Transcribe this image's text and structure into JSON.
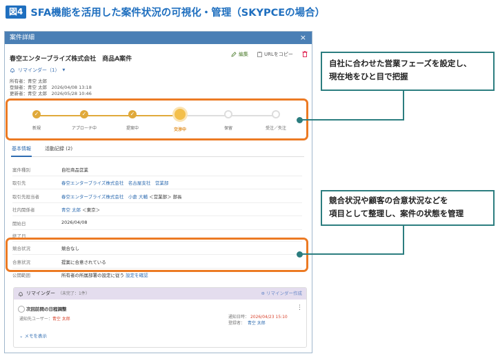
{
  "figure": {
    "badge": "図4",
    "title": "SFA機能を活用した案件状況の可視化・管理（SKYPCEの場合）"
  },
  "panel": {
    "header_title": "案件詳細",
    "close_glyph": "×",
    "deal_title": "春空エンターブライズ株式会社　商品A案件",
    "actions": {
      "edit": "編集",
      "copy_url": "URLをコピー"
    },
    "reminder_label": "リマインダー（1）",
    "meta": [
      {
        "label": "所有者：",
        "value": "青空 太郎"
      },
      {
        "label": "登録者：",
        "value": "青空 太郎　2026/04/08 13:18"
      },
      {
        "label": "更新者：",
        "value": "青空 太郎　2026/05/28 10:46"
      }
    ],
    "stages": [
      {
        "label": "新規",
        "status": "done"
      },
      {
        "label": "アプローチ中",
        "status": "done"
      },
      {
        "label": "提案中",
        "status": "done"
      },
      {
        "label": "交渉中",
        "status": "current"
      },
      {
        "label": "保留",
        "status": "todo"
      },
      {
        "label": "受注／失注",
        "status": "todo"
      }
    ],
    "tabs": [
      {
        "label": "基本情報",
        "active": true
      },
      {
        "label": "活動記録 (2)",
        "active": false
      }
    ],
    "fields": [
      {
        "label": "案件種別",
        "value": "自社商品営業"
      },
      {
        "label": "取引先",
        "value": "春空エンターブライズ株式会社　名古屋支社　営業部"
      },
      {
        "label": "取引先担当者",
        "link": "春空エンターブライズ株式会社　小倉 大輔",
        "suffix": "＜営業部＞ 部長"
      },
      {
        "label": "社内関係者",
        "link": "青空 太郎",
        "suffix": "＜東京＞"
      },
      {
        "label": "開始日",
        "value": "2026/04/08"
      },
      {
        "label": "終了日",
        "value": ""
      },
      {
        "label": "競合状況",
        "value": "競合なし"
      },
      {
        "label": "合意状況",
        "value": "提案に合意されている"
      },
      {
        "label": "公開範囲",
        "value": "所有者の所属部署の設定に従う",
        "link": "設定を確認"
      }
    ],
    "reminder_box": {
      "title": "リマインダー",
      "count": "（未完了：1件）",
      "create": "リマインダー作成",
      "item_title": "次回訪問の日程調整",
      "notify_label": "通知先ユーザー：",
      "notify_user": "青空 太郎",
      "notify_date_label": "通知日時：",
      "notify_date": "2026/04/23 15:10",
      "creator_label": "登録者：",
      "creator": "青空 太郎",
      "memo": "メモを表示"
    }
  },
  "callouts": [
    "自社に合わせた営業フェーズを設定し、\n現在地をひと目で把握",
    "競合状況や顧客の合意状況などを\n項目として整理し、案件の状態を管理"
  ],
  "colors": {
    "accent_blue": "#1f6fbf",
    "highlight_orange": "#ec7a23",
    "callout_teal": "#2b7d7f",
    "stage_done": "#e0a93a"
  }
}
